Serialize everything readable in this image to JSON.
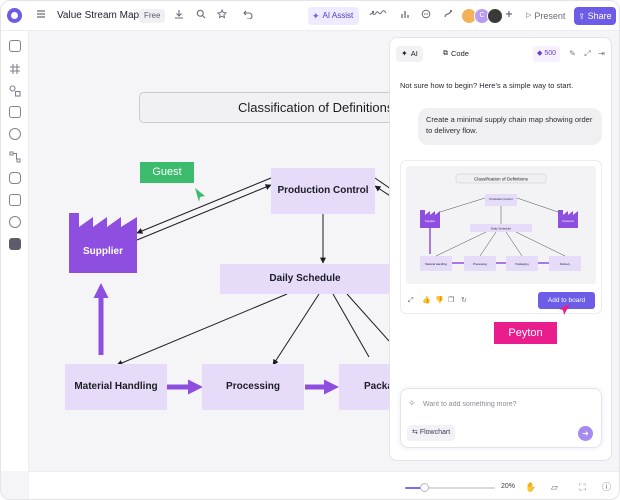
{
  "app": {
    "title": "Value Stream Map",
    "plan_badge": "Free",
    "ai_assist_label": "AI Assist",
    "present_label": "Present",
    "share_label": "Share",
    "collaborators": [
      {
        "initial": "",
        "color": "#f0b35a"
      },
      {
        "initial": "C",
        "color": "#b89cf2"
      },
      {
        "initial": "",
        "color": "#3a3a3a"
      }
    ]
  },
  "sidebar": {
    "icons": [
      "frame-icon",
      "hash-icon",
      "shapes-icon",
      "image-icon",
      "sticky-note-icon",
      "connector-icon",
      "template-icon",
      "embed-icon",
      "ai-icon",
      "apps-icon"
    ]
  },
  "board": {
    "title": "Classification of Definitions",
    "nodes": {
      "supplier": "Supplier",
      "production_control": "Production Control",
      "daily_schedule": "Daily Schedule",
      "material_handling": "Material Handling",
      "processing": "Processing",
      "packaging": "Packaging"
    },
    "cursor_labels": {
      "guest": "Guest",
      "peyton": "Peyton"
    },
    "colors": {
      "node_fill": "#e6dcfa",
      "accent": "#8e4fe0",
      "guest": "#3dbb6c",
      "peyton": "#e91e8c"
    }
  },
  "ai_panel": {
    "tabs": [
      "AI",
      "Code"
    ],
    "credits": "500",
    "intro": "Not sure how to begin? Here's a simple way to start.",
    "prompt": "Create a minimal supply chain map showing order to delivery flow.",
    "preview": {
      "title": "Classification of Definitions",
      "nodes": [
        "Production Control",
        "Daily Schedule",
        "Supplier",
        "Customer",
        "Material Handling",
        "Processing",
        "Packaging",
        "Delivery"
      ]
    },
    "add_to_board": "Add to board",
    "input_placeholder": "Want to add something more?",
    "chip": "Flowchart"
  },
  "bottom": {
    "zoom_fraction": 0.22,
    "zoom_label": "20%"
  }
}
